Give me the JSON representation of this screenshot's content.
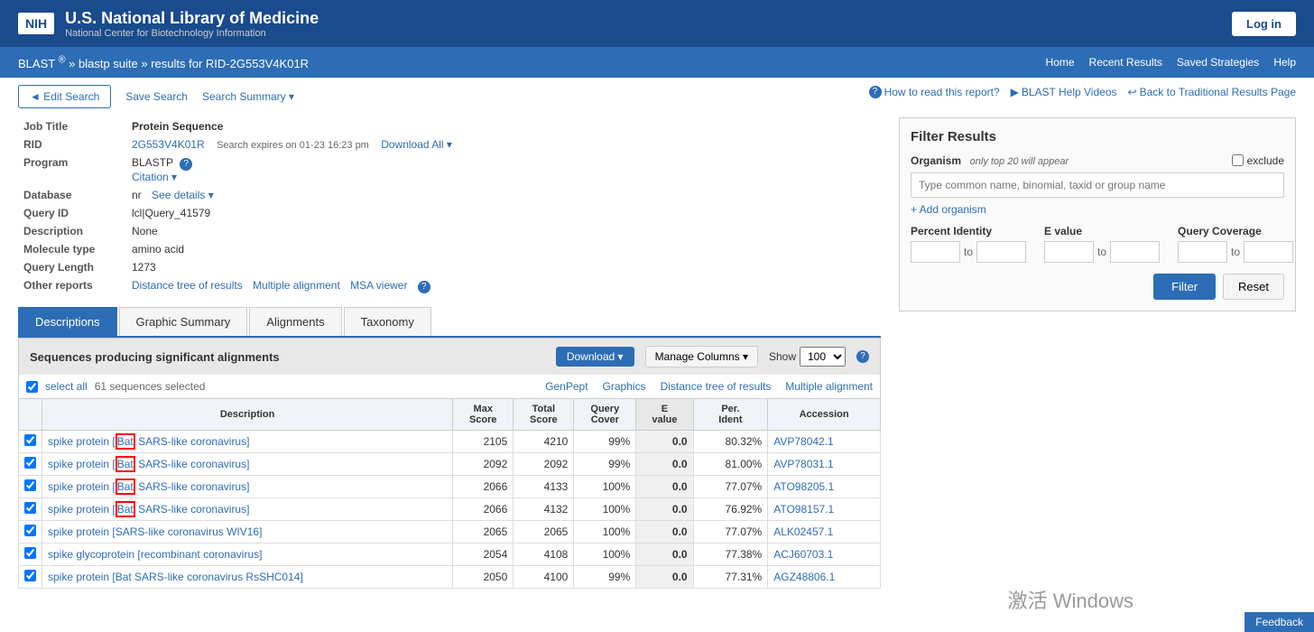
{
  "header": {
    "nih_logo": "NIH",
    "title": "U.S. National Library of Medicine",
    "subtitle": "National Center for Biotechnology Information",
    "login_label": "Log in"
  },
  "nav": {
    "breadcrumb": "BLAST ® » blastp suite » results for RID-2G553V4K01R",
    "links": [
      "Home",
      "Recent Results",
      "Saved Strategies",
      "Help"
    ]
  },
  "toolbar": {
    "edit_search": "◄ Edit Search",
    "save_search": "Save Search",
    "search_summary": "Search Summary ▾"
  },
  "help_links": {
    "how_to_read": "How to read this report?",
    "blast_help": "BLAST Help Videos",
    "back_traditional": "Back to Traditional Results Page"
  },
  "job_info": {
    "job_title_label": "Job Title",
    "job_title_value": "Protein Sequence",
    "rid_label": "RID",
    "rid_value": "2G553V4K01R",
    "expires": "Search expires on 01-23 16:23 pm",
    "download_all": "Download All ▾",
    "program_label": "Program",
    "program_value": "BLASTP",
    "citation": "Citation ▾",
    "database_label": "Database",
    "database_value": "nr",
    "see_details": "See details ▾",
    "query_id_label": "Query ID",
    "query_id_value": "lcl|Query_41579",
    "description_label": "Description",
    "description_value": "None",
    "molecule_label": "Molecule type",
    "molecule_value": "amino acid",
    "query_length_label": "Query Length",
    "query_length_value": "1273",
    "other_reports_label": "Other reports",
    "distance_tree": "Distance tree of results",
    "multiple_alignment": "Multiple alignment",
    "msa_viewer": "MSA viewer"
  },
  "tabs": [
    "Descriptions",
    "Graphic Summary",
    "Alignments",
    "Taxonomy"
  ],
  "active_tab": 0,
  "sequences": {
    "header": "Sequences producing significant alignments",
    "download": "Download ▾",
    "manage_columns": "Manage Columns ▾",
    "show_label": "Show",
    "show_value": "100",
    "select_all": "select all",
    "count": "61 sequences selected",
    "links": [
      "GenPept",
      "Graphics",
      "Distance tree of results",
      "Multiple alignment"
    ],
    "columns": [
      "Description",
      "Max Score",
      "Total Score",
      "Query Cover",
      "E value",
      "Per. Ident",
      "Accession"
    ],
    "rows": [
      {
        "desc": "spike protein [Bat SARS-like coronavirus]",
        "bat_highlight": true,
        "max_score": "2105",
        "total_score": "4210",
        "query_cover": "99%",
        "e_value": "0.0",
        "per_ident": "80.32%",
        "accession": "AVP78042.1"
      },
      {
        "desc": "spike protein [Bat SARS-like coronavirus]",
        "bat_highlight": true,
        "max_score": "2092",
        "total_score": "2092",
        "query_cover": "99%",
        "e_value": "0.0",
        "per_ident": "81.00%",
        "accession": "AVP78031.1"
      },
      {
        "desc": "spike protein [Bat SARS-like coronavirus]",
        "bat_highlight": true,
        "max_score": "2066",
        "total_score": "4133",
        "query_cover": "100%",
        "e_value": "0.0",
        "per_ident": "77.07%",
        "accession": "ATO98205.1"
      },
      {
        "desc": "spike protein [Bat SARS-like coronavirus]",
        "bat_highlight": true,
        "max_score": "2066",
        "total_score": "4132",
        "query_cover": "100%",
        "e_value": "0.0",
        "per_ident": "76.92%",
        "accession": "ATO98157.1"
      },
      {
        "desc": "spike protein [SARS-like coronavirus WIV16]",
        "bat_highlight": false,
        "max_score": "2065",
        "total_score": "2065",
        "query_cover": "100%",
        "e_value": "0.0",
        "per_ident": "77.07%",
        "accession": "ALK02457.1"
      },
      {
        "desc": "spike glycoprotein [recombinant coronavirus]",
        "bat_highlight": false,
        "max_score": "2054",
        "total_score": "4108",
        "query_cover": "100%",
        "e_value": "0.0",
        "per_ident": "77.38%",
        "accession": "ACJ60703.1"
      },
      {
        "desc": "spike protein [Bat SARS-like coronavirus RsSHC014]",
        "bat_highlight": false,
        "max_score": "2050",
        "total_score": "4100",
        "query_cover": "99%",
        "e_value": "0.0",
        "per_ident": "77.31%",
        "accession": "AGZ48806.1"
      }
    ]
  },
  "filter": {
    "title": "Filter Results",
    "organism_label": "Organism",
    "organism_note": "only top 20 will appear",
    "exclude_label": "exclude",
    "organism_placeholder": "Type common name, binomial, taxid or group name",
    "add_organism": "+ Add organism",
    "percent_identity_label": "Percent Identity",
    "e_value_label": "E value",
    "query_coverage_label": "Query Coverage",
    "to_label": "to",
    "filter_btn": "Filter",
    "reset_btn": "Reset"
  },
  "feedback": "Feedback",
  "watermark": "激活 Windows"
}
